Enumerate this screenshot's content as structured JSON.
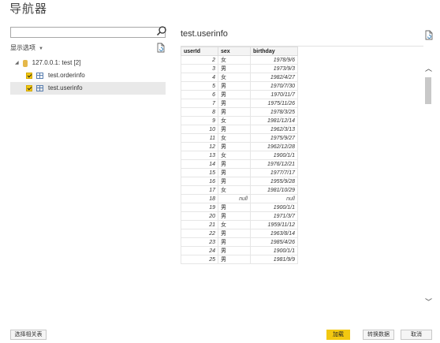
{
  "window": {
    "title": "导航器"
  },
  "left": {
    "search": {
      "placeholder": ""
    },
    "options_label": "显示选项",
    "tree": {
      "server": "127.0.0.1: test [2]",
      "tables": [
        {
          "name": "test.orderinfo",
          "checked": true,
          "selected": false
        },
        {
          "name": "test.userinfo",
          "checked": true,
          "selected": true
        }
      ]
    }
  },
  "preview": {
    "title": "test.userinfo",
    "columns": [
      "userId",
      "sex",
      "birthday"
    ],
    "rows": [
      [
        "2",
        "女",
        "1978/9/6"
      ],
      [
        "3",
        "男",
        "1973/9/3"
      ],
      [
        "4",
        "女",
        "1982/4/27"
      ],
      [
        "5",
        "男",
        "1970/7/30"
      ],
      [
        "6",
        "男",
        "1970/11/7"
      ],
      [
        "7",
        "男",
        "1975/11/26"
      ],
      [
        "8",
        "男",
        "1978/3/25"
      ],
      [
        "9",
        "女",
        "1981/12/14"
      ],
      [
        "10",
        "男",
        "1962/3/13"
      ],
      [
        "11",
        "女",
        "1975/9/27"
      ],
      [
        "12",
        "男",
        "1962/12/28"
      ],
      [
        "13",
        "女",
        "1900/1/1"
      ],
      [
        "14",
        "男",
        "1976/12/21"
      ],
      [
        "15",
        "男",
        "1977/7/17"
      ],
      [
        "16",
        "男",
        "1955/9/28"
      ],
      [
        "17",
        "女",
        "1981/10/29"
      ],
      [
        "18",
        "null",
        "null"
      ],
      [
        "19",
        "男",
        "1900/1/1"
      ],
      [
        "20",
        "男",
        "1971/3/7"
      ],
      [
        "21",
        "女",
        "1959/11/12"
      ],
      [
        "22",
        "男",
        "1963/8/14"
      ],
      [
        "23",
        "男",
        "1985/4/26"
      ],
      [
        "24",
        "男",
        "1900/1/1"
      ],
      [
        "25",
        "男",
        "1981/9/9"
      ]
    ]
  },
  "footer": {
    "related_label": "选择相关表",
    "load_label": "加载",
    "transform_label": "转换数据",
    "cancel_label": "取消"
  },
  "colors": {
    "accent": "#f2c811",
    "selected_row": "#e9e9e9"
  },
  "icons": [
    "search-icon",
    "refresh-icon",
    "database-icon",
    "table-icon",
    "chevron-up-icon",
    "chevron-down-icon"
  ]
}
